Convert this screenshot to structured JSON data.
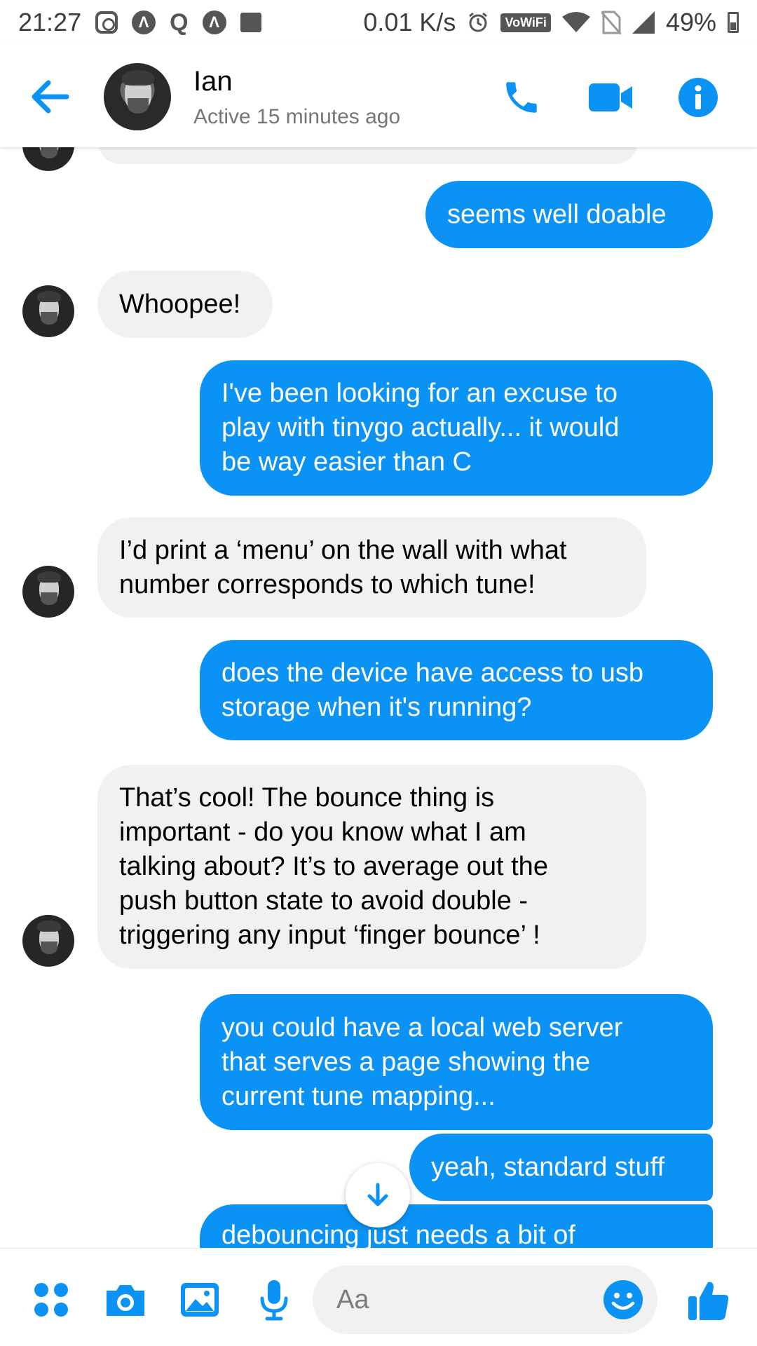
{
  "status_bar": {
    "time": "21:27",
    "network_speed": "0.01 K/s",
    "wifi_badge": "VoWiFi",
    "battery": "49%"
  },
  "header": {
    "contact_name": "Ian",
    "contact_status": "Active 15 minutes ago"
  },
  "conversation": {
    "messages": [
      {
        "direction": "out",
        "text": "seems well doable"
      },
      {
        "direction": "in",
        "text": "Whoopee!"
      },
      {
        "direction": "out",
        "text": "I've been looking for an excuse to\nplay with tinygo actually... it would\nbe way easier than C"
      },
      {
        "direction": "in",
        "text": "I’d print a ‘menu’ on the wall with what\nnumber corresponds to which tune!"
      },
      {
        "direction": "out",
        "text": "does the device have access to usb\nstorage when it's running?"
      },
      {
        "direction": "in",
        "text": "That’s cool!  The bounce thing is\nimportant - do you know what I am\ntalking about?  It’s to average out the\npush button state to avoid double -\ntriggering any input ‘finger bounce’ !"
      },
      {
        "direction": "out",
        "text": "you could have a local web server\nthat serves a page showing the\ncurrent tune mapping..."
      },
      {
        "direction": "out",
        "text": "yeah, standard stuff"
      },
      {
        "direction": "out",
        "text": "debouncing just needs a bit of"
      }
    ]
  },
  "composer": {
    "placeholder": "Aa"
  },
  "colors": {
    "accent": "#0a93f5",
    "incoming_bubble": "#f1f1f1"
  },
  "icons": [
    "arrow-left-icon",
    "phone-icon",
    "video-camera-icon",
    "info-icon",
    "arrow-down-icon",
    "apps-grid-icon",
    "camera-icon",
    "gallery-icon",
    "microphone-icon",
    "emoji-icon",
    "thumbs-up-icon"
  ]
}
